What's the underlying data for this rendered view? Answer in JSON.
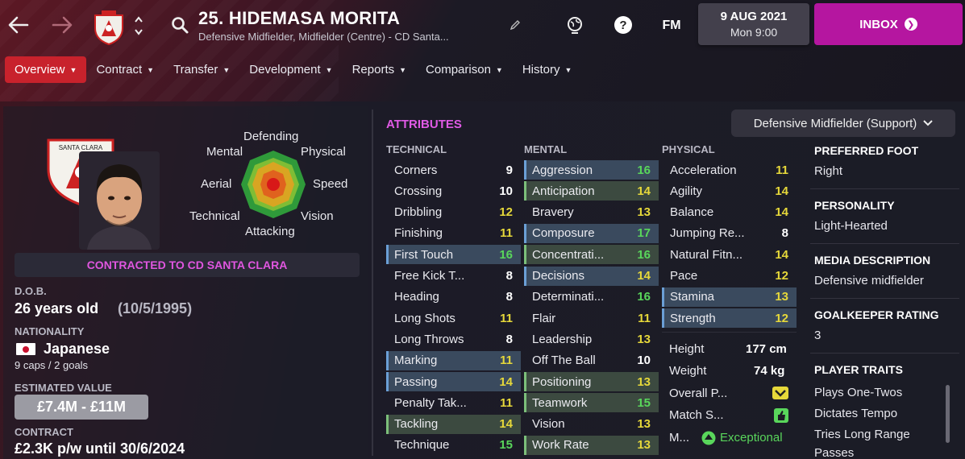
{
  "header": {
    "title": "25. HIDEMASA MORITA",
    "subtitle": "Defensive Midfielder, Midfielder (Centre) - CD Santa...",
    "date": "9 AUG 2021",
    "time": "Mon 9:00",
    "fm_label": "FM",
    "inbox_label": "INBOX"
  },
  "tabs": [
    "Overview",
    "Contract",
    "Transfer",
    "Development",
    "Reports",
    "Comparison",
    "History"
  ],
  "radar": {
    "labels": [
      "Defending",
      "Physical",
      "Speed",
      "Vision",
      "Attacking",
      "Technical",
      "Aerial",
      "Mental"
    ]
  },
  "profile": {
    "contracted": "CONTRACTED TO CD SANTA CLARA",
    "dob_label": "D.O.B.",
    "age": "26 years old",
    "dob": "(10/5/1995)",
    "nationality_label": "NATIONALITY",
    "nationality": "Japanese",
    "caps": "9 caps / 2 goals",
    "value_label": "ESTIMATED VALUE",
    "value": "£7.4M - £11M",
    "contract_label": "CONTRACT",
    "contract": "£2.3K p/w until 30/6/2024",
    "club_logo_text": "SANTA CLARA"
  },
  "attributes": {
    "heading": "ATTRIBUTES",
    "role": "Defensive Midfielder (Support)",
    "technical_label": "TECHNICAL",
    "mental_label": "MENTAL",
    "physical_label": "PHYSICAL",
    "technical": [
      {
        "name": "Corners",
        "value": "9"
      },
      {
        "name": "Crossing",
        "value": "10"
      },
      {
        "name": "Dribbling",
        "value": "12"
      },
      {
        "name": "Finishing",
        "value": "11"
      },
      {
        "name": "First Touch",
        "value": "16"
      },
      {
        "name": "Free Kick T...",
        "value": "8"
      },
      {
        "name": "Heading",
        "value": "8"
      },
      {
        "name": "Long Shots",
        "value": "11"
      },
      {
        "name": "Long Throws",
        "value": "8"
      },
      {
        "name": "Marking",
        "value": "11"
      },
      {
        "name": "Passing",
        "value": "14"
      },
      {
        "name": "Penalty Tak...",
        "value": "11"
      },
      {
        "name": "Tackling",
        "value": "14"
      },
      {
        "name": "Technique",
        "value": "15"
      }
    ],
    "mental": [
      {
        "name": "Aggression",
        "value": "16"
      },
      {
        "name": "Anticipation",
        "value": "14"
      },
      {
        "name": "Bravery",
        "value": "13"
      },
      {
        "name": "Composure",
        "value": "17"
      },
      {
        "name": "Concentrati...",
        "value": "16"
      },
      {
        "name": "Decisions",
        "value": "14"
      },
      {
        "name": "Determinati...",
        "value": "16"
      },
      {
        "name": "Flair",
        "value": "11"
      },
      {
        "name": "Leadership",
        "value": "13"
      },
      {
        "name": "Off The Ball",
        "value": "10"
      },
      {
        "name": "Positioning",
        "value": "13"
      },
      {
        "name": "Teamwork",
        "value": "15"
      },
      {
        "name": "Vision",
        "value": "13"
      },
      {
        "name": "Work Rate",
        "value": "13"
      }
    ],
    "physical": [
      {
        "name": "Acceleration",
        "value": "11"
      },
      {
        "name": "Agility",
        "value": "14"
      },
      {
        "name": "Balance",
        "value": "14"
      },
      {
        "name": "Jumping Re...",
        "value": "8"
      },
      {
        "name": "Natural Fitn...",
        "value": "14"
      },
      {
        "name": "Pace",
        "value": "12"
      },
      {
        "name": "Stamina",
        "value": "13"
      },
      {
        "name": "Strength",
        "value": "12"
      }
    ],
    "extra": {
      "height_label": "Height",
      "height": "177 cm",
      "weight_label": "Weight",
      "weight": "74 kg",
      "overall_label": "Overall P...",
      "match_label": "Match S...",
      "morale_label": "M...",
      "morale": "Exceptional"
    }
  },
  "info": {
    "foot_label": "PREFERRED FOOT",
    "foot": "Right",
    "personality_label": "PERSONALITY",
    "personality": "Light-Hearted",
    "media_label": "MEDIA DESCRIPTION",
    "media": "Defensive midfielder",
    "gk_label": "GOALKEEPER RATING",
    "gk": "3",
    "traits_label": "PLAYER TRAITS",
    "traits": [
      "Plays One-Twos",
      "Dictates Tempo",
      "Tries Long Range",
      "Passes"
    ]
  },
  "colors": {
    "accent": "#c8222c",
    "inbox": "#b516a0",
    "heading": "#e05ae5",
    "green": "#59d65b",
    "yellow": "#e6d83a"
  }
}
